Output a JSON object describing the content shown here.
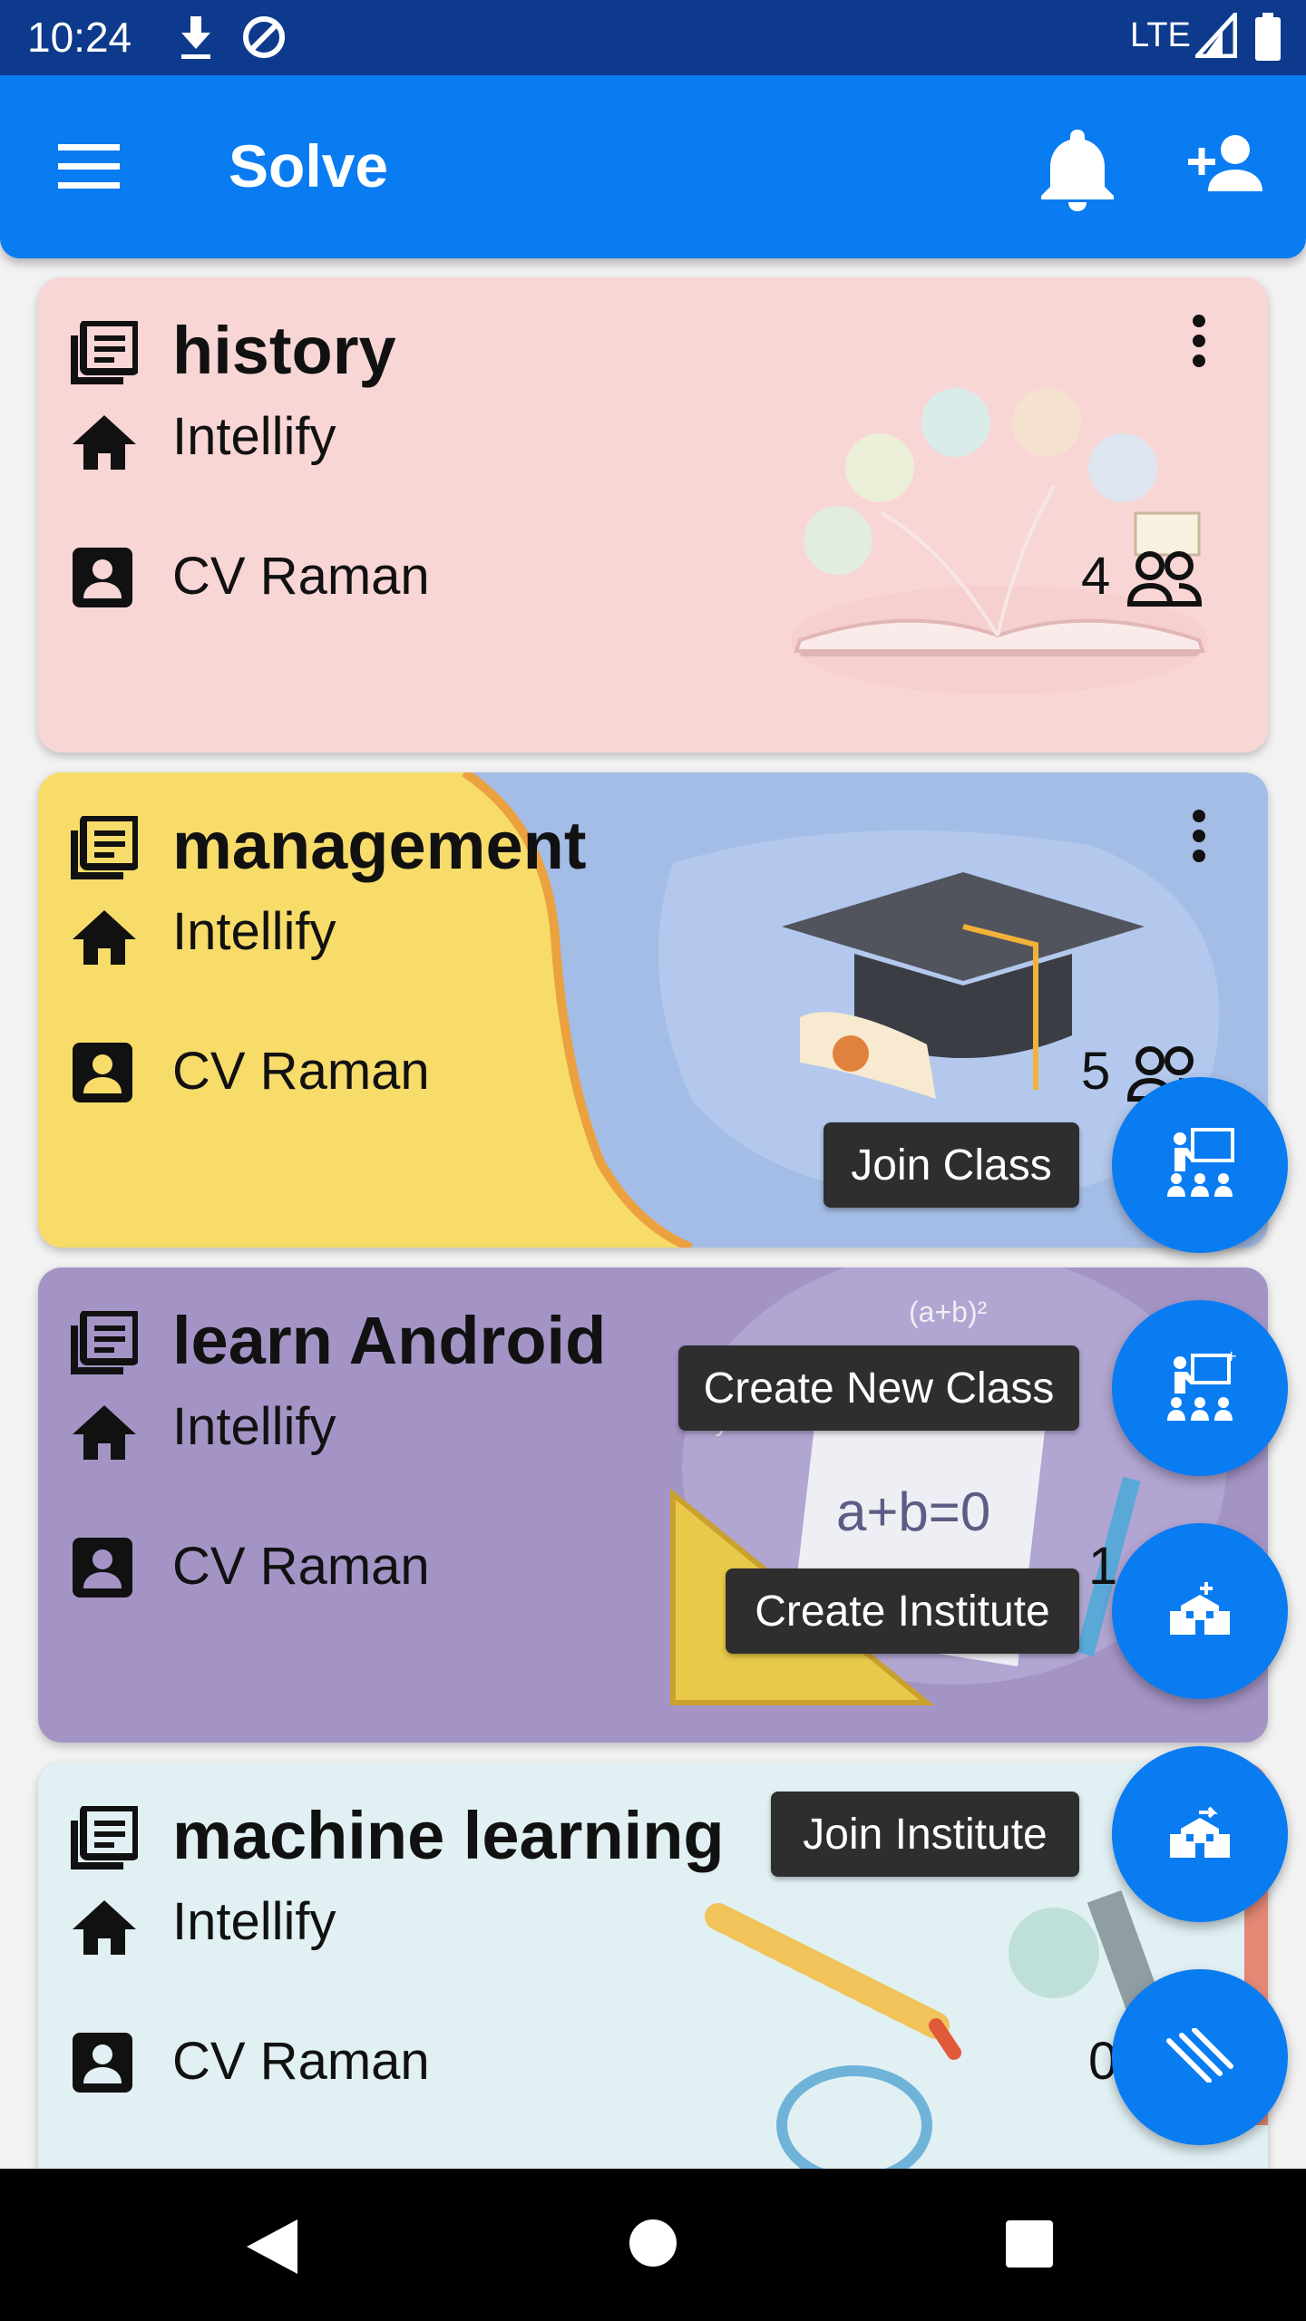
{
  "status_bar": {
    "time": "10:24",
    "network": "LTE"
  },
  "app_bar": {
    "title": "Solve"
  },
  "colors": {
    "primary": "#0a7cf2",
    "status_bar": "#0d3a8c",
    "tooltip": "#2e2e2e",
    "card_history": "#f9d6d6",
    "card_management_yellow": "#f7dc6a",
    "card_management_blue": "#a4bde6",
    "card_android": "#a494c6",
    "card_ml": "#e1f0f3"
  },
  "cards": [
    {
      "title": "history",
      "institute": "Intellify",
      "owner": "CV Raman",
      "members": "4"
    },
    {
      "title": "management",
      "institute": "Intellify",
      "owner": "CV Raman",
      "members": "5"
    },
    {
      "title": "learn Android",
      "institute": "Intellify",
      "owner": "CV Raman",
      "members": "1"
    },
    {
      "title": "machine learning",
      "institute": "Intellify",
      "owner": "CV Raman",
      "members": "0"
    }
  ],
  "art_text": {
    "formula_1": "a+b=0",
    "formula_2": "(a+b)²",
    "formula_3": "x+y=?"
  },
  "fab_menu": [
    {
      "label": "Join Class",
      "icon": "teacher-class-icon"
    },
    {
      "label": "Create New Class",
      "icon": "teacher-class-add-icon"
    },
    {
      "label": "Create Institute",
      "icon": "school-add-icon"
    },
    {
      "label": "Join Institute",
      "icon": "school-join-icon"
    },
    {
      "label": "",
      "icon": "close-fab-icon"
    }
  ]
}
